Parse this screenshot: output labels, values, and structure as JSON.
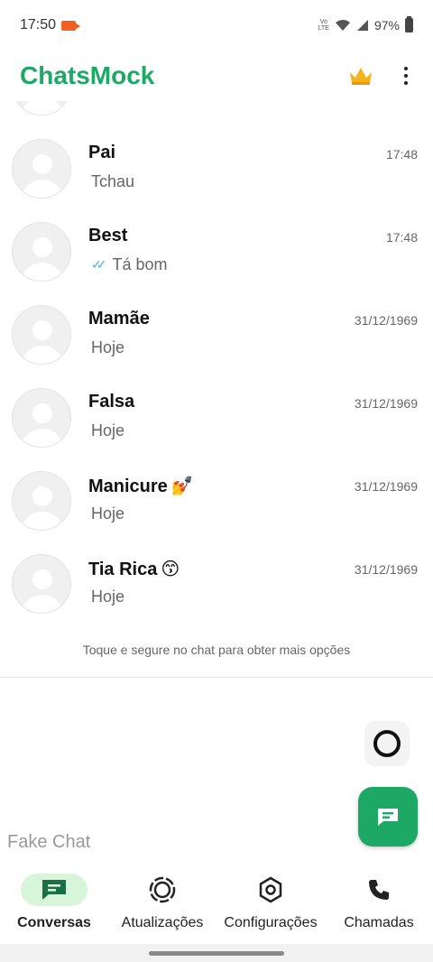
{
  "status_bar": {
    "time": "17:50",
    "volte_top": "Vo",
    "volte_bottom": "LTE",
    "battery": "97%"
  },
  "app_bar": {
    "title": "ChatsMock"
  },
  "chats": [
    {
      "name": "Pai",
      "time": "17:48",
      "last_message": "Tchau",
      "emoji": "",
      "read_ticks": false
    },
    {
      "name": "Best",
      "time": "17:48",
      "last_message": "Tá bom",
      "emoji": "",
      "read_ticks": true
    },
    {
      "name": "Mamãe",
      "time": "31/12/1969",
      "last_message": "Hoje",
      "emoji": "",
      "read_ticks": false
    },
    {
      "name": "Falsa",
      "time": "31/12/1969",
      "last_message": "Hoje",
      "emoji": "",
      "read_ticks": false
    },
    {
      "name": "Manicure",
      "time": "31/12/1969",
      "last_message": "Hoje",
      "emoji": "💅",
      "read_ticks": false
    },
    {
      "name": "Tia Rica",
      "time": "31/12/1969",
      "last_message": "Hoje",
      "emoji": "😙",
      "read_ticks": false
    }
  ],
  "hint": "Toque e segure no chat para obter mais opções",
  "watermark": "Fake Chat",
  "nav": [
    {
      "label": "Conversas",
      "icon": "chat-icon",
      "active": true
    },
    {
      "label": "Atualizações",
      "icon": "status-icon",
      "active": false
    },
    {
      "label": "Configurações",
      "icon": "settings-icon",
      "active": false
    },
    {
      "label": "Chamadas",
      "icon": "phone-icon",
      "active": false
    }
  ],
  "colors": {
    "brand": "#1ea866",
    "active_nav_bg": "#d7f5d9",
    "read_ticks": "#3cb4e5"
  }
}
